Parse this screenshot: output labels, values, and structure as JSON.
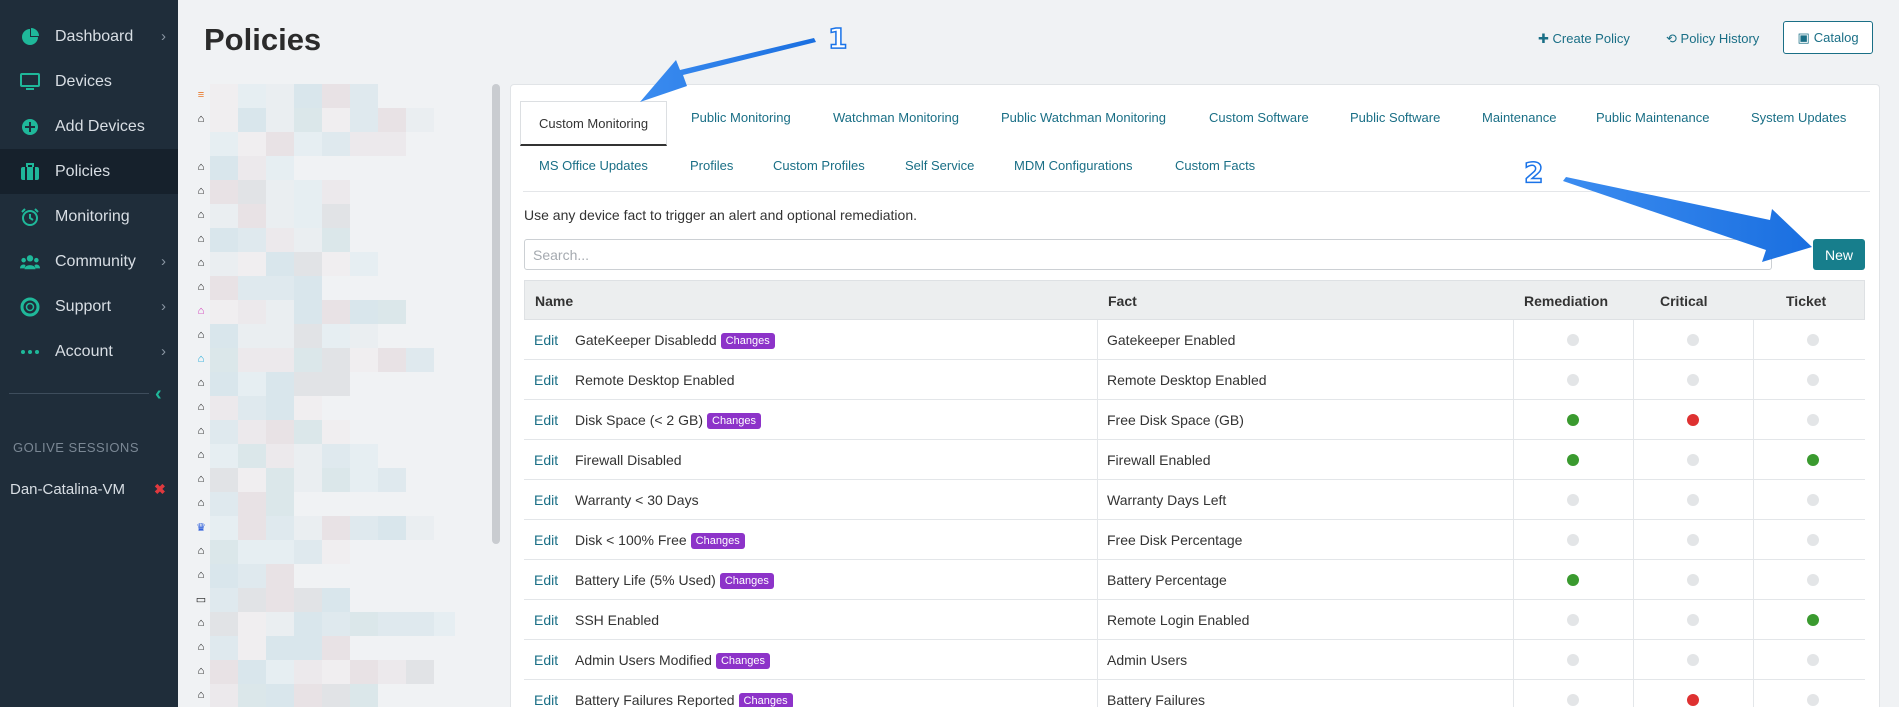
{
  "sidebar": {
    "items": [
      {
        "label": "Dashboard",
        "icon": "pie-chart-icon",
        "chevron": true
      },
      {
        "label": "Devices",
        "icon": "monitor-icon",
        "chevron": false
      },
      {
        "label": "Add Devices",
        "icon": "plus-circle-icon",
        "chevron": false
      },
      {
        "label": "Policies",
        "icon": "briefcase-icon",
        "chevron": false,
        "active": true
      },
      {
        "label": "Monitoring",
        "icon": "alarm-clock-icon",
        "chevron": false
      },
      {
        "label": "Community",
        "icon": "users-icon",
        "chevron": true
      },
      {
        "label": "Support",
        "icon": "life-ring-icon",
        "chevron": true
      },
      {
        "label": "Account",
        "icon": "ellipsis-icon",
        "chevron": true
      }
    ],
    "section_title": "GOLIVE SESSIONS",
    "session_name": "Dan-Catalina-VM"
  },
  "header": {
    "title": "Policies",
    "create_policy": "Create Policy",
    "policy_history": "Policy History",
    "catalog": "Catalog"
  },
  "tabs": {
    "row1": [
      "Custom Monitoring",
      "Public Monitoring",
      "Watchman Monitoring",
      "Public Watchman Monitoring",
      "Custom Software",
      "Public Software",
      "Maintenance",
      "Public Maintenance",
      "System Updates"
    ],
    "row2": [
      "MS Office Updates",
      "Profiles",
      "Custom Profiles",
      "Self Service",
      "MDM Configurations",
      "Custom Facts"
    ],
    "active": "Custom Monitoring"
  },
  "main": {
    "description": "Use any device fact to trigger an alert and optional remediation.",
    "search_placeholder": "Search...",
    "new_label": "New"
  },
  "table": {
    "headers": [
      "Name",
      "Fact",
      "Remediation",
      "Critical",
      "Ticket"
    ],
    "edit_label": "Edit",
    "badge_label": "Changes",
    "rows": [
      {
        "name": "GateKeeper Disabledd",
        "changes": true,
        "fact": "Gatekeeper Enabled",
        "remediation": false,
        "critical": false,
        "ticket": false
      },
      {
        "name": "Remote Desktop Enabled",
        "changes": false,
        "fact": "Remote Desktop Enabled",
        "remediation": false,
        "critical": false,
        "ticket": false
      },
      {
        "name": "Disk Space (< 2 GB)",
        "changes": true,
        "fact": "Free Disk Space (GB)",
        "remediation": true,
        "critical": true,
        "ticket": false
      },
      {
        "name": "Firewall Disabled",
        "changes": false,
        "fact": "Firewall Enabled",
        "remediation": true,
        "critical": false,
        "ticket": true
      },
      {
        "name": "Warranty < 30 Days",
        "changes": false,
        "fact": "Warranty Days Left",
        "remediation": false,
        "critical": false,
        "ticket": false
      },
      {
        "name": "Disk < 100% Free",
        "changes": true,
        "fact": "Free Disk Percentage",
        "remediation": false,
        "critical": false,
        "ticket": false
      },
      {
        "name": "Battery Life (5% Used)",
        "changes": true,
        "fact": "Battery Percentage",
        "remediation": true,
        "critical": false,
        "ticket": false
      },
      {
        "name": "SSH Enabled",
        "changes": false,
        "fact": "Remote Login Enabled",
        "remediation": false,
        "critical": false,
        "ticket": true
      },
      {
        "name": "Admin Users Modified",
        "changes": true,
        "fact": "Admin Users",
        "remediation": false,
        "critical": false,
        "ticket": false
      },
      {
        "name": "Battery Failures Reported",
        "changes": true,
        "fact": "Battery Failures",
        "remediation": false,
        "critical": true,
        "ticket": false
      }
    ]
  },
  "annotations": {
    "one": "1",
    "two": "2"
  },
  "colors": {
    "accent": "#177e8c",
    "link": "#1a6f86",
    "badge": "#8d33c9",
    "dot_on_green": "#3a9a2f",
    "dot_on_red": "#de3131",
    "dot_off": "#e3e5e7",
    "sidebar_bg": "#1f2d3a",
    "sidebar_icon": "#1fb89a",
    "annotation": "#1a73e8"
  }
}
